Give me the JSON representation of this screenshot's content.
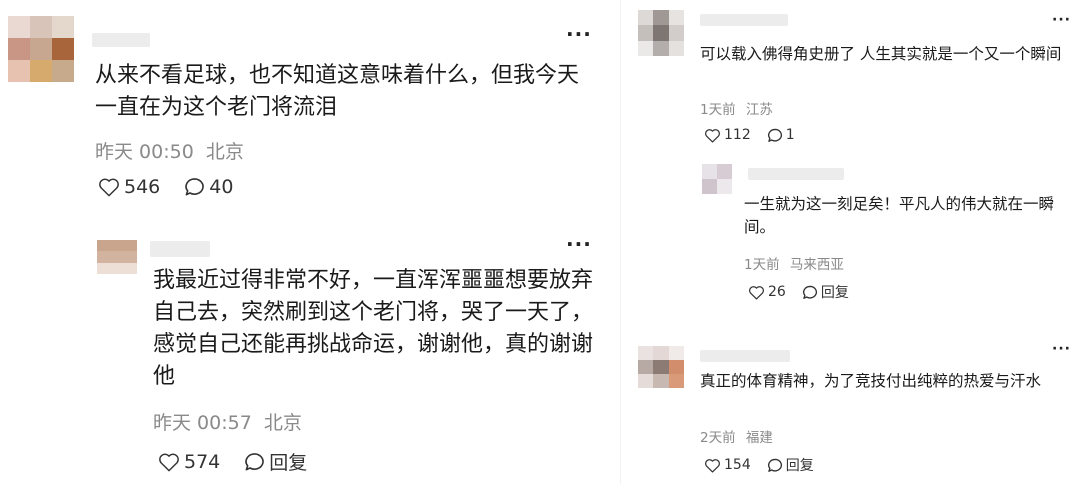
{
  "left": {
    "comment1": {
      "text": "从来不看足球，也不知道这意味着什么，但我今天一直在为这个老门将流泪",
      "time": "昨天 00:50",
      "location": "北京",
      "likes": "546",
      "replies": "40",
      "more": "···"
    },
    "comment2": {
      "text": "我最近过得非常不好，一直浑浑噩噩想要放弃自己去，突然刷到这个老门将，哭了一天了，感觉自己还能再挑战命运，谢谢他，真的谢谢他",
      "time": "昨天 00:57",
      "location": "北京",
      "likes": "574",
      "reply_label": "回复",
      "more": "···"
    }
  },
  "right": {
    "comment1": {
      "text": "可以载入佛得角史册了 人生其实就是一个又一个瞬间",
      "time": "1天前",
      "location": "江苏",
      "likes": "112",
      "replies": "1",
      "more": "···"
    },
    "comment2": {
      "text": "一生就为这一刻足矣！平凡人的伟大就在一瞬间。",
      "time": "1天前",
      "location": "马来西亚",
      "likes": "26",
      "reply_label": "回复",
      "more": "···"
    },
    "comment3": {
      "text": "真正的体育精神，为了竞技付出纯粹的热爱与汗水",
      "time": "2天前",
      "location": "福建",
      "likes": "154",
      "reply_label": "回复",
      "more": "···"
    }
  },
  "icons": {
    "like": "heart-icon",
    "comment": "speech-bubble-icon",
    "more": "more-dots-icon"
  },
  "colors": {
    "text": "#1a1a1a",
    "meta": "#8a8a8a",
    "action": "#333333"
  }
}
